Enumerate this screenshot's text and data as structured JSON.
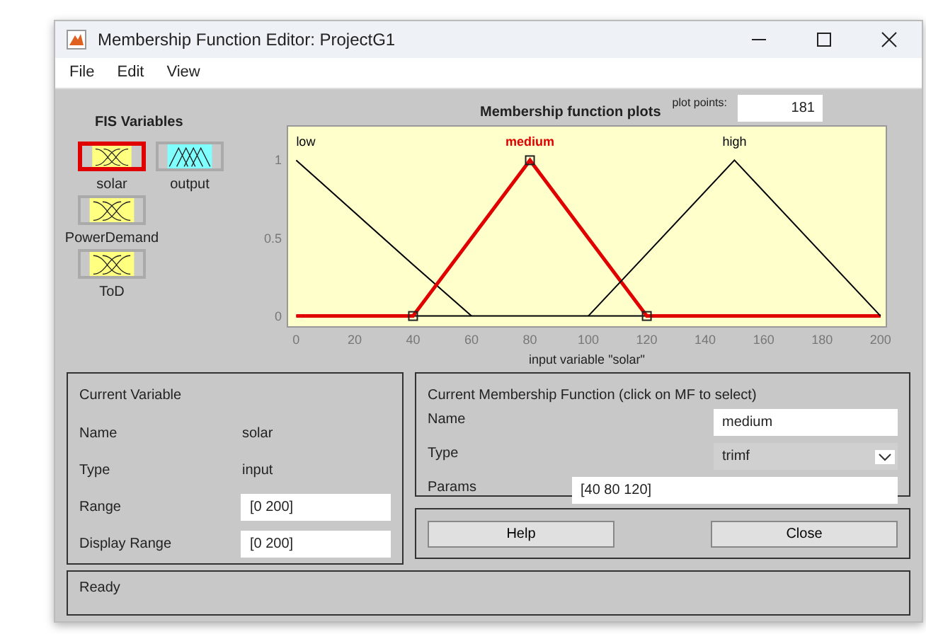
{
  "window": {
    "title": "Membership Function Editor: ProjectG1"
  },
  "menu": [
    "File",
    "Edit",
    "View"
  ],
  "fis_variables": {
    "title": "FIS Variables",
    "items": [
      {
        "name": "solar",
        "kind": "input",
        "selected": true
      },
      {
        "name": "output",
        "kind": "output",
        "selected": false
      },
      {
        "name": "PowerDemand",
        "kind": "input",
        "selected": false
      },
      {
        "name": "ToD",
        "kind": "input",
        "selected": false
      }
    ]
  },
  "plot": {
    "plot_points_label": "plot points:",
    "plot_points": "181",
    "chart_data": {
      "type": "line",
      "title": "Membership function plots",
      "xlabel": "input variable \"solar\"",
      "x": [
        0,
        40,
        60,
        80,
        100,
        120,
        150,
        200
      ],
      "series": [
        {
          "name": "low",
          "color": "#000000",
          "values": [
            1,
            0.33,
            0,
            null,
            null,
            null,
            null,
            null
          ]
        },
        {
          "name": "medium",
          "color": "#e00000",
          "values": [
            0,
            0,
            0.5,
            1,
            0.5,
            0,
            0,
            0
          ]
        },
        {
          "name": "high",
          "color": "#000000",
          "values": [
            null,
            null,
            null,
            null,
            0,
            0.4,
            1,
            0
          ]
        }
      ],
      "xlim": [
        -3,
        202
      ],
      "ylim": [
        -0.07,
        1.22
      ],
      "xticks": [
        0,
        20,
        40,
        60,
        80,
        100,
        120,
        140,
        160,
        180,
        200
      ],
      "yticks": [
        0,
        0.5,
        1
      ]
    }
  },
  "current_variable": {
    "title": "Current Variable",
    "name_label": "Name",
    "name": "solar",
    "type_label": "Type",
    "type": "input",
    "range_label": "Range",
    "range": "[0 200]",
    "display_range_label": "Display Range",
    "display_range": "[0 200]"
  },
  "current_mf": {
    "title": "Current Membership Function (click on MF to select)",
    "name_label": "Name",
    "name": "medium",
    "type_label": "Type",
    "type": "trimf",
    "params_label": "Params",
    "params": "[40 80 120]"
  },
  "buttons": [
    "Help",
    "Close"
  ],
  "status_bar": "Ready"
}
